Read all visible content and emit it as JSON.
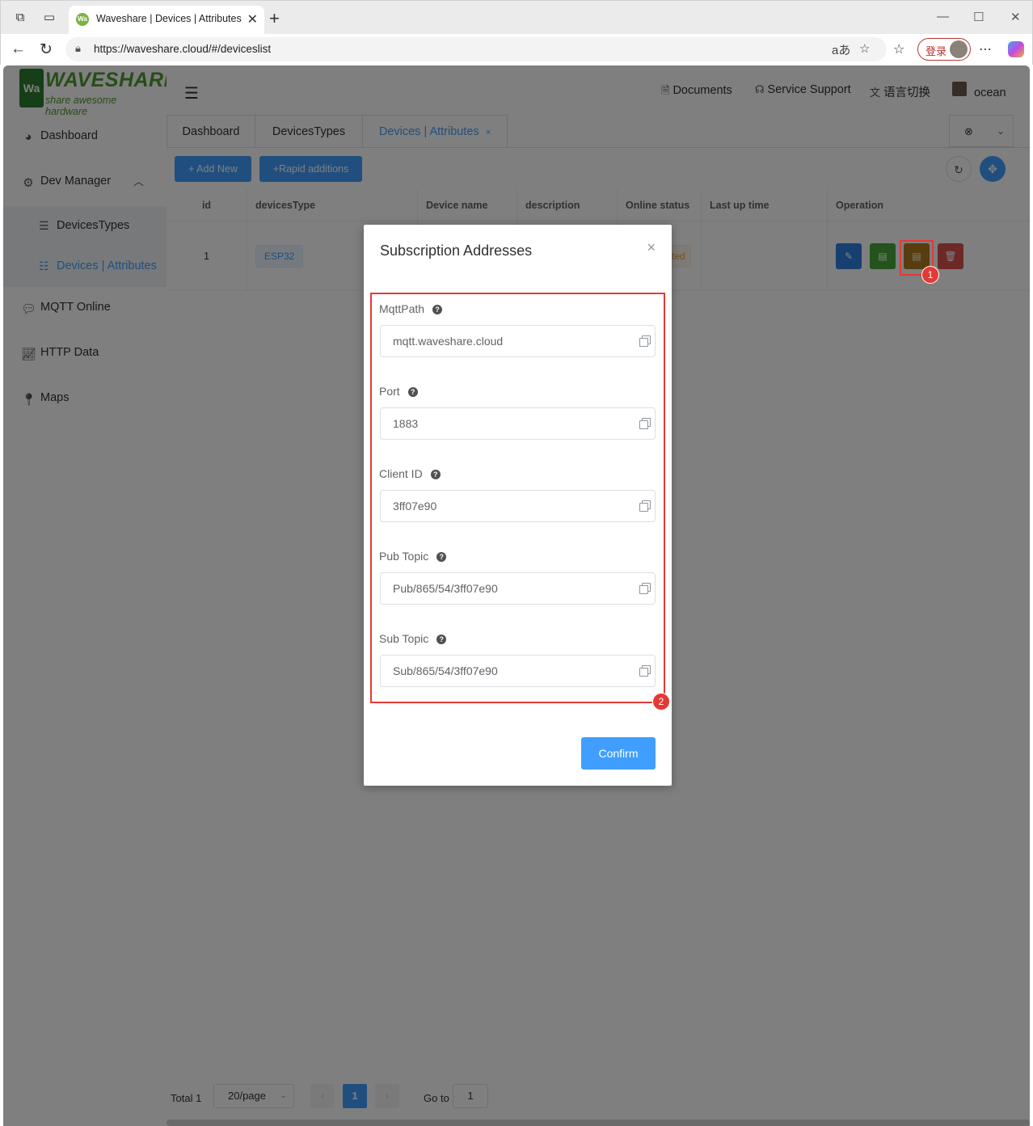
{
  "browser": {
    "tab_title": "Waveshare | Devices | Attributes",
    "url": "https://waveshare.cloud/#/deviceslist",
    "login_label": "登录"
  },
  "logo": {
    "name": "WAVESHARE",
    "tagline": "share awesome hardware",
    "mark": "Wa"
  },
  "sidebar": {
    "items": [
      {
        "label": "Dashboard",
        "icon": "pie-chart-icon"
      },
      {
        "label": "Dev Manager",
        "icon": "gear-icon"
      },
      {
        "label": "MQTT Online",
        "icon": "chat-icon"
      },
      {
        "label": "HTTP Data",
        "icon": "line-chart-icon"
      },
      {
        "label": "Maps",
        "icon": "location-pin-icon"
      }
    ],
    "submenu": [
      {
        "label": "DevicesTypes",
        "icon": "list-icon"
      },
      {
        "label": "Devices | Attributes",
        "icon": "bullet-list-icon"
      }
    ]
  },
  "header": {
    "documents": "Documents",
    "service_support": "Service Support",
    "language": "语言切换",
    "user": "ocean"
  },
  "page_tabs": [
    {
      "label": "Dashboard"
    },
    {
      "label": "DevicesTypes"
    },
    {
      "label": "Devices | Attributes",
      "close": "×"
    }
  ],
  "toolbar": {
    "add_new": "+ Add New",
    "rapid": "+Rapid additions"
  },
  "table": {
    "columns": [
      "id",
      "devicesType",
      "Device name",
      "description",
      "Online status",
      "Last up time",
      "Operation"
    ],
    "rows": [
      {
        "id": "1",
        "devicesType": "ESP32",
        "online_status": "ted",
        "last_up": "."
      }
    ]
  },
  "pagination": {
    "total": "Total 1",
    "page_size": "20/page",
    "current": "1",
    "goto_label": "Go to",
    "goto_value": "1"
  },
  "dialog": {
    "title": "Subscription Addresses",
    "close": "×",
    "fields": [
      {
        "label": "MqttPath",
        "value": "mqtt.waveshare.cloud"
      },
      {
        "label": "Port",
        "value": "1883"
      },
      {
        "label": "Client ID",
        "value": "3ff07e90"
      },
      {
        "label": "Pub Topic",
        "value": "Pub/865/54/3ff07e90"
      },
      {
        "label": "Sub Topic",
        "value": "Sub/865/54/3ff07e90"
      }
    ],
    "confirm": "Confirm"
  },
  "annotations": {
    "one": "1",
    "two": "2"
  },
  "colors": {
    "primary": "#409eff",
    "edit": "#2f7fe0",
    "view": "#4aa63a",
    "subscribe": "#b07a20",
    "delete": "#d9534f",
    "annotation": "#e53935"
  }
}
